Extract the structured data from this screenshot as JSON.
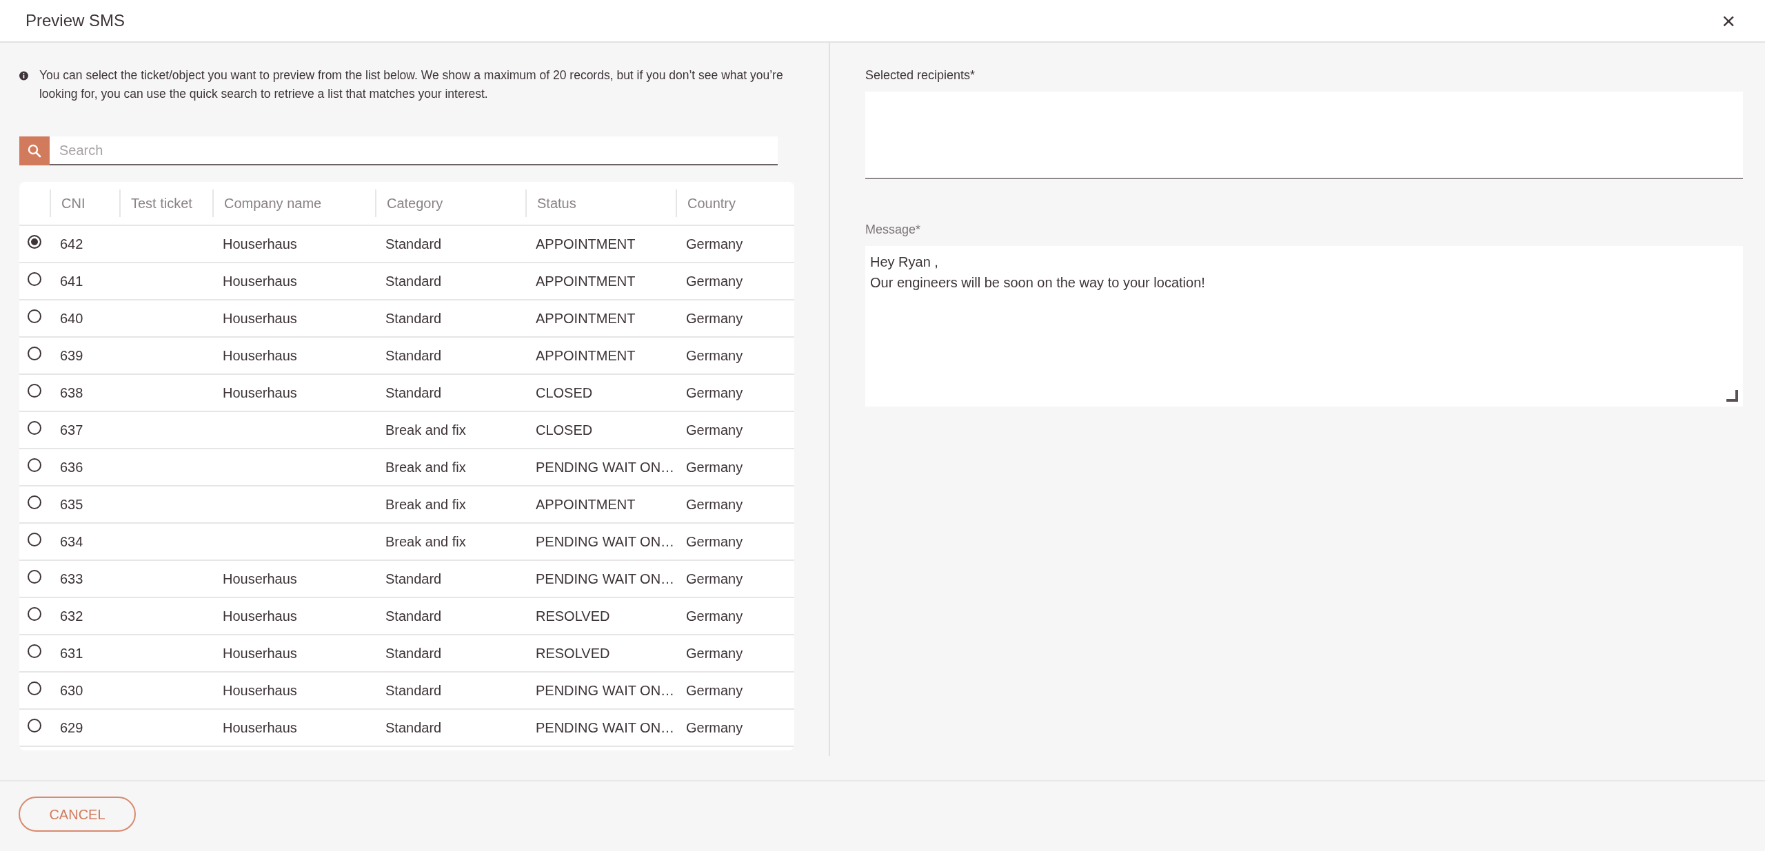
{
  "window": {
    "title": "Preview SMS",
    "close": "×"
  },
  "info": "You can select the ticket/object you want to preview from the list below. We show a maximum of 20 records, but if you don’t see what you’re looking for, you can use the quick search to retrieve a list that matches your interest.",
  "search": {
    "placeholder": "Search"
  },
  "table": {
    "columns": [
      "CNI",
      "Test ticket",
      "Company name",
      "Category",
      "Status",
      "Country"
    ],
    "rows": [
      {
        "selected": true,
        "cells": [
          "642",
          "",
          "Houserhaus",
          "Standard",
          "APPOINTMENT",
          "Germany"
        ]
      },
      {
        "selected": false,
        "cells": [
          "641",
          "",
          "Houserhaus",
          "Standard",
          "APPOINTMENT",
          "Germany"
        ]
      },
      {
        "selected": false,
        "cells": [
          "640",
          "",
          "Houserhaus",
          "Standard",
          "APPOINTMENT",
          "Germany"
        ]
      },
      {
        "selected": false,
        "cells": [
          "639",
          "",
          "Houserhaus",
          "Standard",
          "APPOINTMENT",
          "Germany"
        ]
      },
      {
        "selected": false,
        "cells": [
          "638",
          "",
          "Houserhaus",
          "Standard",
          "CLOSED",
          "Germany"
        ]
      },
      {
        "selected": false,
        "cells": [
          "637",
          "",
          "",
          "Break and fix",
          "CLOSED",
          "Germany"
        ]
      },
      {
        "selected": false,
        "cells": [
          "636",
          "",
          "",
          "Break and fix",
          "PENDING WAIT ON…",
          "Germany"
        ]
      },
      {
        "selected": false,
        "cells": [
          "635",
          "",
          "",
          "Break and fix",
          "APPOINTMENT",
          "Germany"
        ]
      },
      {
        "selected": false,
        "cells": [
          "634",
          "",
          "",
          "Break and fix",
          "PENDING WAIT ON…",
          "Germany"
        ]
      },
      {
        "selected": false,
        "cells": [
          "633",
          "",
          "Houserhaus",
          "Standard",
          "PENDING WAIT ON…",
          "Germany"
        ]
      },
      {
        "selected": false,
        "cells": [
          "632",
          "",
          "Houserhaus",
          "Standard",
          "RESOLVED",
          "Germany"
        ]
      },
      {
        "selected": false,
        "cells": [
          "631",
          "",
          "Houserhaus",
          "Standard",
          "RESOLVED",
          "Germany"
        ]
      },
      {
        "selected": false,
        "cells": [
          "630",
          "",
          "Houserhaus",
          "Standard",
          "PENDING WAIT ON…",
          "Germany"
        ]
      },
      {
        "selected": false,
        "cells": [
          "629",
          "",
          "Houserhaus",
          "Standard",
          "PENDING WAIT ON…",
          "Germany"
        ]
      }
    ]
  },
  "recipients": {
    "label": "Selected recipients*"
  },
  "message": {
    "label": "Message*",
    "value": "Hey Ryan ,\nOur engineers will be soon on the way to your location!"
  },
  "buttons": [
    "CANCEL"
  ]
}
